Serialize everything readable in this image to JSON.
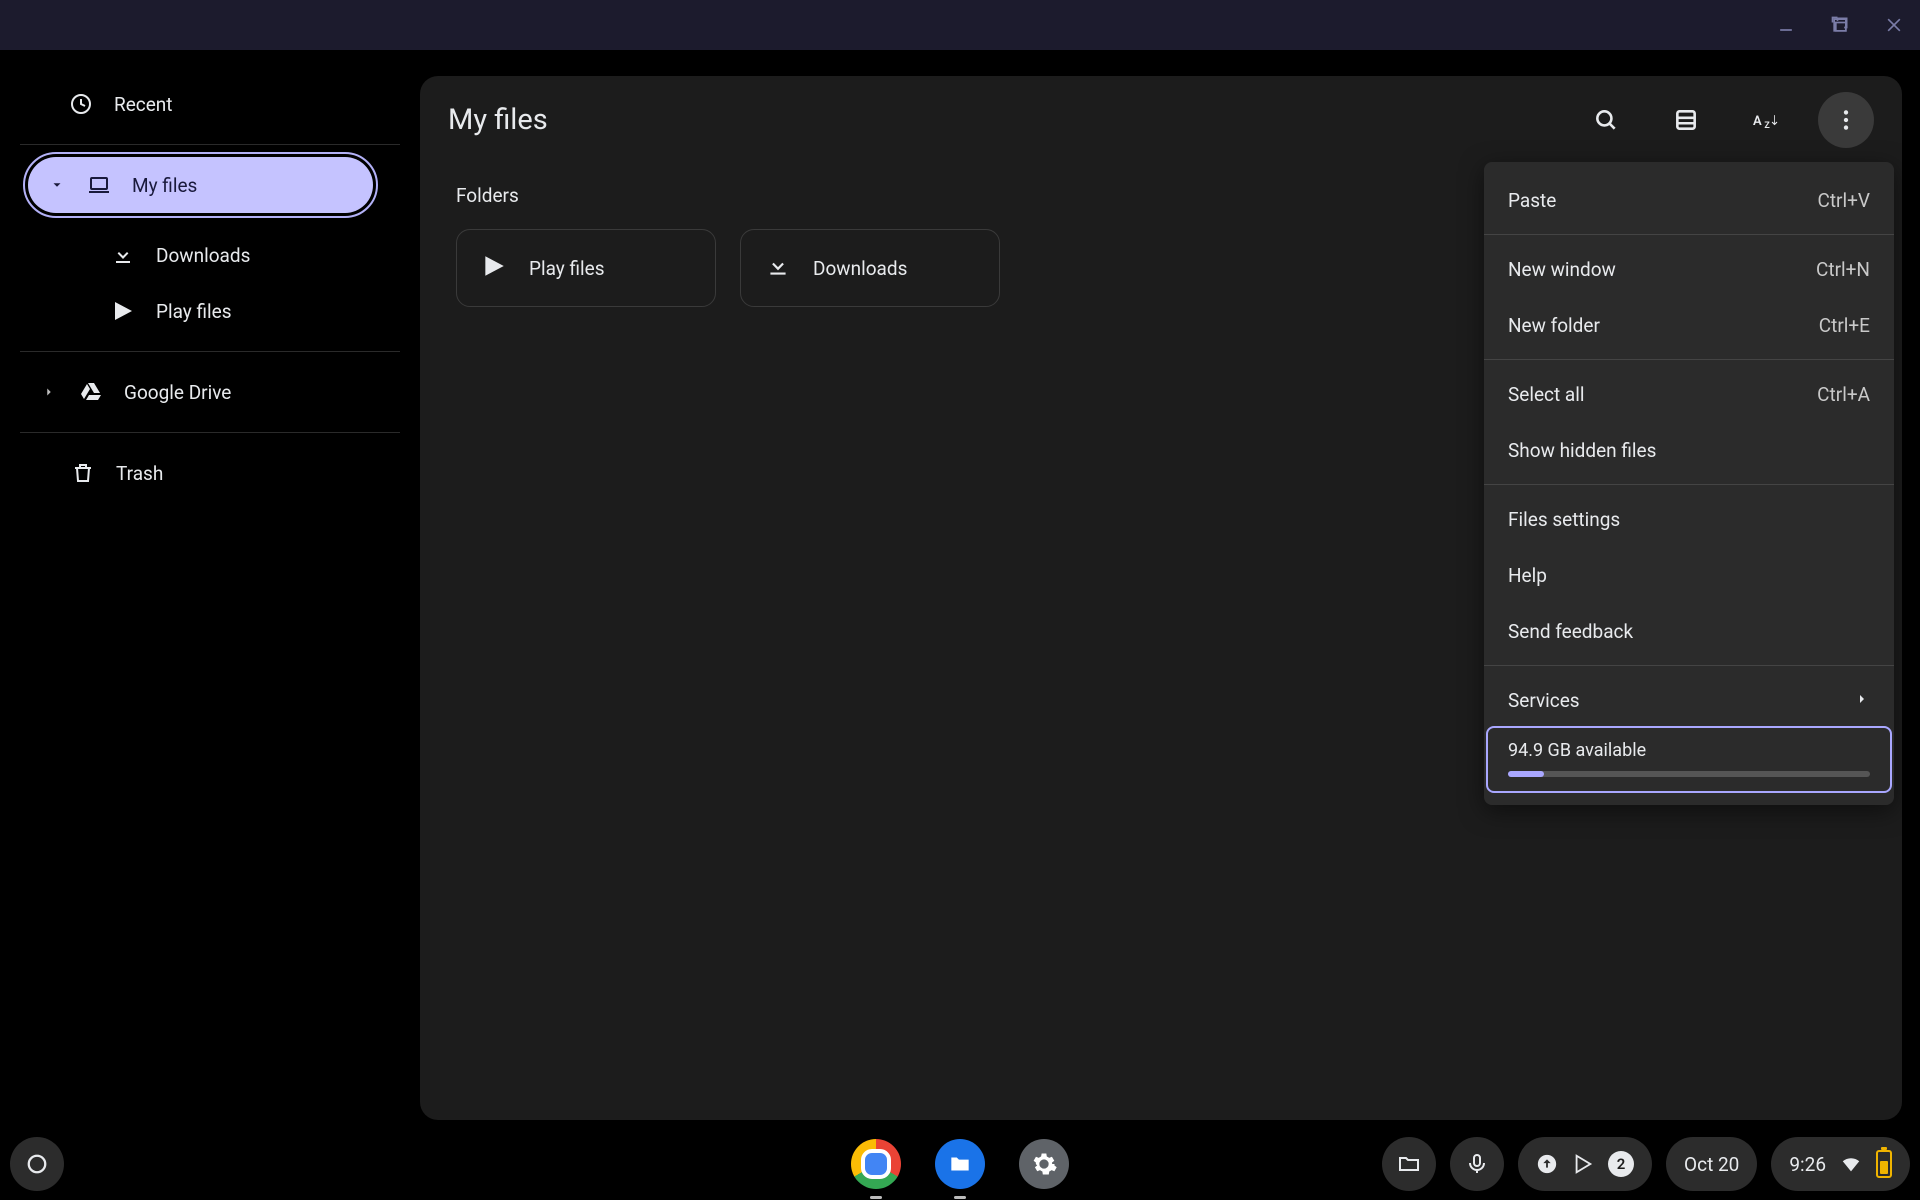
{
  "window": {
    "sidebar": {
      "recent": "Recent",
      "my_files": "My files",
      "downloads": "Downloads",
      "play_files": "Play files",
      "google_drive": "Google Drive",
      "trash": "Trash"
    },
    "main": {
      "title": "My files",
      "section_folders": "Folders",
      "folders": {
        "play_files": "Play files",
        "downloads": "Downloads"
      }
    },
    "menu": {
      "paste": "Paste",
      "paste_kbd": "Ctrl+V",
      "new_window": "New window",
      "new_window_kbd": "Ctrl+N",
      "new_folder": "New folder",
      "new_folder_kbd": "Ctrl+E",
      "select_all": "Select all",
      "select_all_kbd": "Ctrl+A",
      "show_hidden": "Show hidden files",
      "files_settings": "Files settings",
      "help": "Help",
      "send_feedback": "Send feedback",
      "services": "Services",
      "storage_available": "94.9 GB available",
      "storage_used_pct": 10
    }
  },
  "shelf": {
    "notifications_count": "2",
    "date": "Oct 20",
    "time": "9:26"
  }
}
